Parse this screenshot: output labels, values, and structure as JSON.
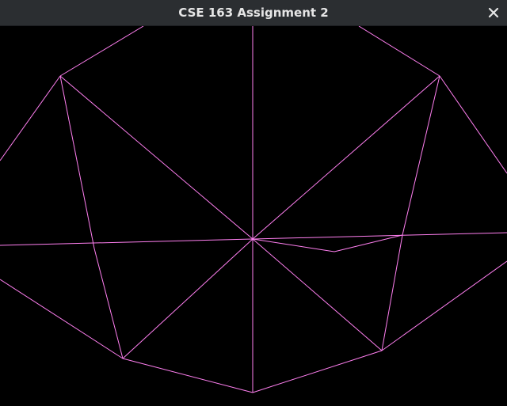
{
  "window": {
    "title": "CSE 163 Assignment 2"
  },
  "icons": {
    "close": "close-icon"
  },
  "colors": {
    "titlebar": "#2b2e31",
    "title_text": "#e6e6e6",
    "viewport_background": "#000000",
    "wireframe": "#ff7ff0"
  }
}
